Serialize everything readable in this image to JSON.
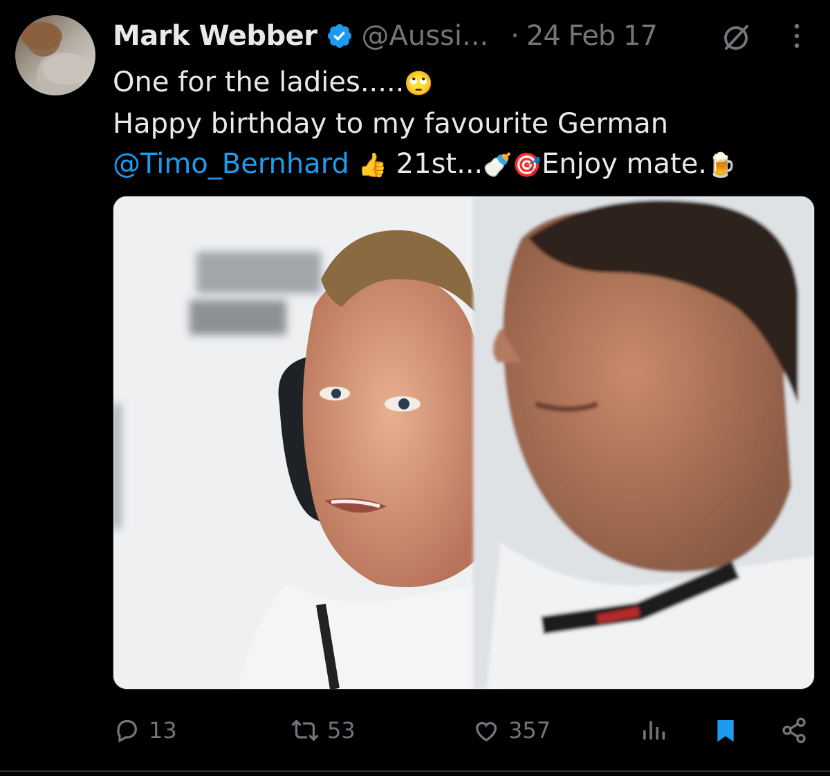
{
  "author": {
    "name": "Mark Webber",
    "handle": "@Aussi...",
    "dot": "·",
    "date": "24 Feb 17",
    "verified_color": "#1d9bf0"
  },
  "tweet": {
    "line1_text": "One for the ladies.....",
    "line1_emoji": "🙄",
    "line2": "Happy birthday to my favourite German",
    "mention": "@Timo_Bernhard",
    "line3_emoji1": "👍",
    "line3_text1": " 21st...",
    "line3_emoji2": "🍼",
    "line3_emoji3": "🎯",
    "line3_text2": "Enjoy mate.",
    "line3_emoji4": "🍺"
  },
  "actions": {
    "replies": "13",
    "reposts": "53",
    "likes": "357",
    "reply_icon": "reply-icon",
    "repost_icon": "repost-icon",
    "like_icon": "heart-icon",
    "views_icon": "views-icon",
    "bookmark_icon": "bookmark-icon",
    "share_icon": "share-icon"
  },
  "colors": {
    "background": "#000000",
    "text": "#e7e9ea",
    "muted": "#71767b",
    "accent": "#1d9bf0"
  }
}
